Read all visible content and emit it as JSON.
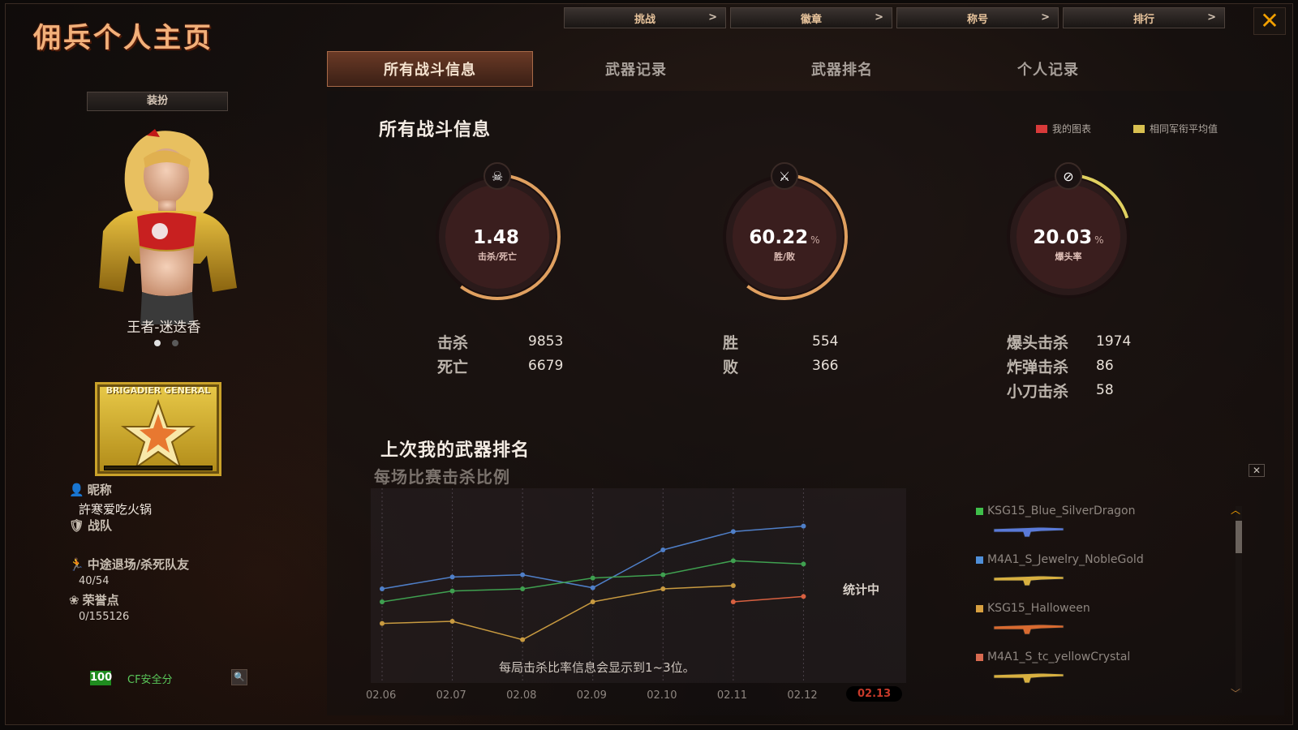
{
  "app": {
    "title": "佣兵个人主页",
    "close": "✕"
  },
  "topnav": [
    {
      "label": "挑战",
      "arrow": ">"
    },
    {
      "label": "徽章",
      "arrow": ">"
    },
    {
      "label": "称号",
      "arrow": ">"
    },
    {
      "label": "排行",
      "arrow": ">"
    }
  ],
  "tabs": [
    {
      "label": "所有战斗信息",
      "active": true
    },
    {
      "label": "武器记录",
      "active": false
    },
    {
      "label": "武器排名",
      "active": false
    },
    {
      "label": "个人记录",
      "active": false
    }
  ],
  "left": {
    "equip_label": "装扮",
    "character_name": "王者-迷迭香",
    "rank_title": "BRIGADIER GENERAL",
    "nickname_label": "昵称",
    "nickname": "許寒爱吃火锅",
    "team_label": "战队",
    "quit_label": "中途退场/杀死队友",
    "quit_value": "40/54",
    "honor_label": "荣誉点",
    "honor_value": "0/155126",
    "safety_score": "100",
    "safety_label": "CF安全分"
  },
  "main": {
    "title": "所有战斗信息",
    "legend_mine": "我的图表",
    "legend_avg": "相同军衔平均值",
    "gauges": [
      {
        "value": "1.48",
        "unit": "",
        "label": "击杀/死亡",
        "icon": "skull-icon",
        "fraction": 0.6
      },
      {
        "value": "60.22",
        "unit": "%",
        "label": "胜/败",
        "icon": "crossed-rifles-icon",
        "fraction": 0.6022
      },
      {
        "value": "20.03",
        "unit": "%",
        "label": "爆头率",
        "icon": "no-knife-icon",
        "fraction": 0.2003
      }
    ],
    "stats": {
      "kill_label": "击杀",
      "kill": "9853",
      "death_label": "死亡",
      "death": "6679",
      "win_label": "胜",
      "win": "554",
      "lose_label": "败",
      "lose": "366",
      "headshot_label": "爆头击杀",
      "headshot": "1974",
      "bomb_label": "炸弹击杀",
      "bomb": "86",
      "knife_label": "小刀击杀",
      "knife": "58"
    },
    "section_title": "上次我的武器排名",
    "section_subtitle": "每场比赛击杀比例",
    "counting": "统计中",
    "chart_note": "每局击杀比率信息会显示到1~3位。"
  },
  "chart_data": {
    "type": "line",
    "categories": [
      "02.06",
      "02.07",
      "02.08",
      "02.09",
      "02.10",
      "02.11",
      "02.12",
      "02.13"
    ],
    "selected_category": "02.13",
    "series": [
      {
        "name": "KSG15_Blue_SilverDragon",
        "color": "#4f7fc8",
        "values": [
          0.72,
          0.83,
          0.85,
          0.73,
          1.08,
          1.25,
          1.3,
          null
        ]
      },
      {
        "name": "M4A1_S_Jewelry_NobleGold",
        "color": "#3fa050",
        "values": [
          0.6,
          0.7,
          0.72,
          0.82,
          0.85,
          0.98,
          0.95,
          null
        ]
      },
      {
        "name": "KSG15_Halloween",
        "color": "#c89a40",
        "values": [
          0.4,
          0.42,
          0.25,
          0.6,
          0.72,
          0.75,
          null,
          null
        ]
      },
      {
        "name": "M4A1_S_tc_yellowCrystal",
        "color": "#d86040",
        "values": [
          null,
          null,
          null,
          null,
          null,
          0.6,
          0.65,
          null
        ]
      }
    ],
    "weapons": [
      {
        "name": "KSG15_Blue_SilverDragon",
        "color": "#3fbf4a"
      },
      {
        "name": "M4A1_S_Jewelry_NobleGold",
        "color": "#4f8fd8"
      },
      {
        "name": "KSG15_Halloween",
        "color": "#d8a040"
      },
      {
        "name": "M4A1_S_tc_yellowCrystal",
        "color": "#d86a50"
      }
    ]
  }
}
